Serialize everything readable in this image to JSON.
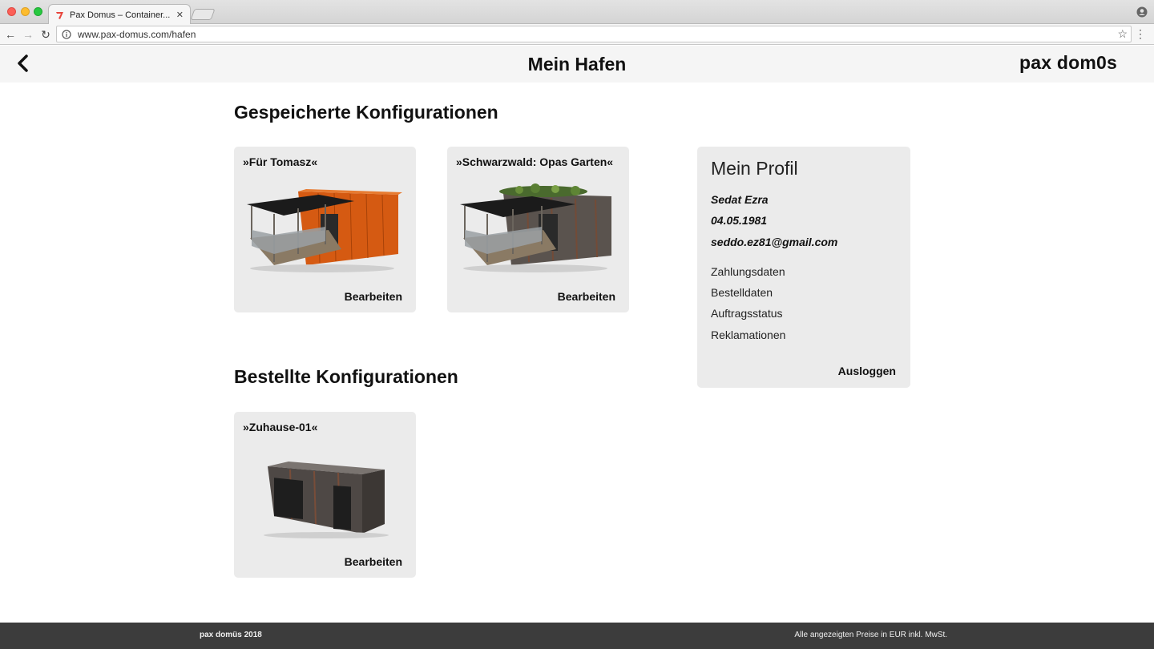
{
  "browser": {
    "tab_title": "Pax Domus – Container...",
    "tab_close": "✕",
    "url": "www.pax-domus.com/hafen",
    "back": "←",
    "forward": "→",
    "reload": "↻",
    "star": "☆",
    "menu": "⋮"
  },
  "header": {
    "title": "Mein Hafen",
    "brand": "pax dom0s"
  },
  "saved": {
    "heading": "Gespeicherte Konfigurationen",
    "items": [
      {
        "title": "»Für Tomasz«",
        "action": "Bearbeiten",
        "icon": "container-house-orange-icon"
      },
      {
        "title": "»Schwarzwald: Opas Garten«",
        "action": "Bearbeiten",
        "icon": "container-house-green-roof-icon"
      }
    ]
  },
  "ordered": {
    "heading": "Bestellte Konfigurationen",
    "items": [
      {
        "title": "»Zuhause-01«",
        "action": "Bearbeiten",
        "icon": "container-rusty-icon"
      }
    ]
  },
  "profile": {
    "heading": "Mein Profil",
    "name": "Sedat Ezra",
    "birthdate": "04.05.1981",
    "email": "seddo.ez81@gmail.com",
    "links": [
      "Zahlungsdaten",
      "Bestelldaten",
      "Auftragsstatus",
      "Reklamationen"
    ],
    "logout": "Ausloggen"
  },
  "footer": {
    "left": "pax domüs 2018",
    "right": "Alle angezeigten Preise in EUR inkl. MwSt."
  }
}
